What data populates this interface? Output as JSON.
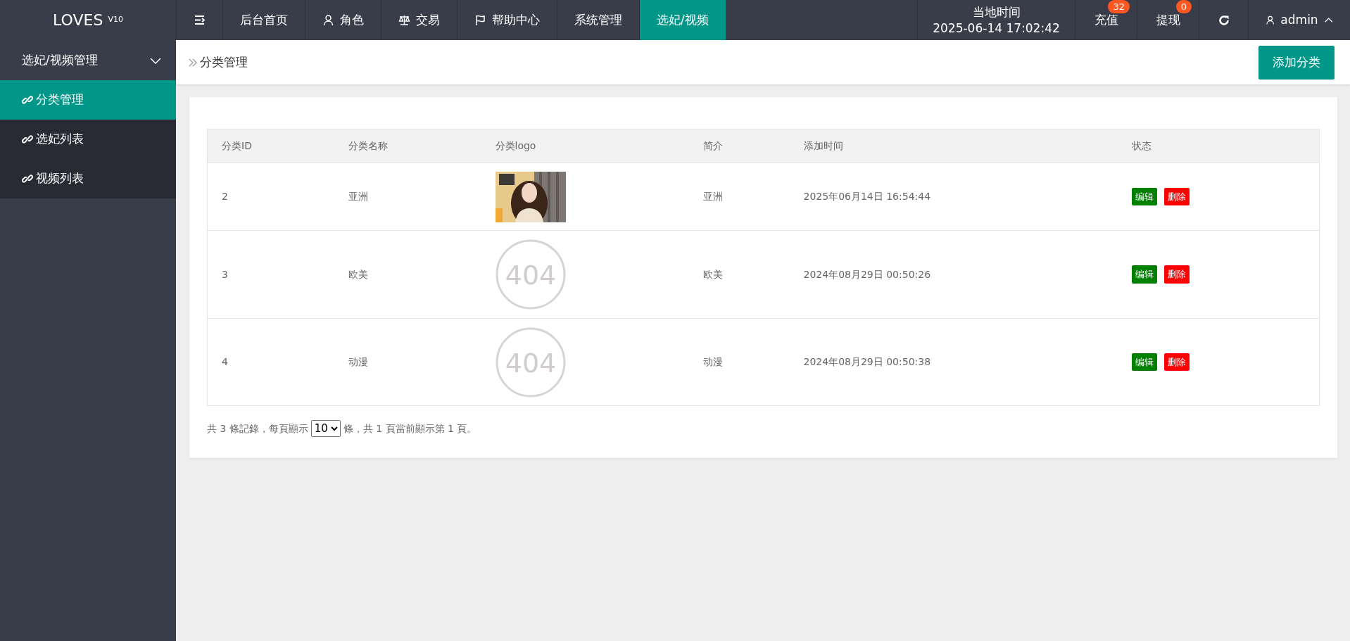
{
  "brand": {
    "name": "LOVES",
    "version": "V10"
  },
  "nav": [
    {
      "kind": "toggle",
      "selected": false
    },
    {
      "label": "后台首页",
      "kind": "plain",
      "selected": false
    },
    {
      "label": "角色",
      "kind": "person",
      "selected": false
    },
    {
      "label": "交易",
      "kind": "scale",
      "selected": false
    },
    {
      "label": "帮助中心",
      "kind": "flag",
      "selected": false
    },
    {
      "label": "系统管理",
      "kind": "plain",
      "selected": false
    },
    {
      "label": "选妃/视频",
      "kind": "plain",
      "selected": true
    }
  ],
  "clock": {
    "label": "当地时间",
    "time": "2025-06-14 17:02:42"
  },
  "top_actions": [
    {
      "label": "充值",
      "badge": "32"
    },
    {
      "label": "提现",
      "badge": "0"
    }
  ],
  "user": {
    "name": "admin",
    "expanded": true
  },
  "sidebar": {
    "group": "选妃/视频管理",
    "expanded": true,
    "items": [
      {
        "label": "分类管理",
        "selected": true
      },
      {
        "label": "选妃列表",
        "selected": false
      },
      {
        "label": "视频列表",
        "selected": false
      }
    ]
  },
  "breadcrumb": "分类管理",
  "add_button": "添加分类",
  "table": {
    "columns": [
      "分类ID",
      "分类名称",
      "分类logo",
      "简介",
      "添加时间",
      "状态"
    ],
    "rows": [
      {
        "id": "2",
        "name": "亚洲",
        "logo": {
          "kind": "picture"
        },
        "intro": "亚洲",
        "time": "2025年06月14日 16:54:44",
        "actions": [
          {
            "label": "编辑",
            "kind": "edit"
          },
          {
            "label": "删除",
            "kind": "delete"
          }
        ]
      },
      {
        "id": "3",
        "name": "欧美",
        "logo": {
          "kind": "missing",
          "text": "404"
        },
        "intro": "欧美",
        "time": "2024年08月29日 00:50:26",
        "actions": [
          {
            "label": "编辑",
            "kind": "edit"
          },
          {
            "label": "删除",
            "kind": "delete"
          }
        ]
      },
      {
        "id": "4",
        "name": "动漫",
        "logo": {
          "kind": "missing",
          "text": "404"
        },
        "intro": "动漫",
        "time": "2024年08月29日 00:50:38",
        "actions": [
          {
            "label": "编辑",
            "kind": "edit"
          },
          {
            "label": "删除",
            "kind": "delete"
          }
        ]
      }
    ]
  },
  "pager": {
    "before": "共 3 條記錄，每頁顯示",
    "page_size": "10",
    "after": "條，共 1 頁當前顯示第 1 頁。"
  }
}
